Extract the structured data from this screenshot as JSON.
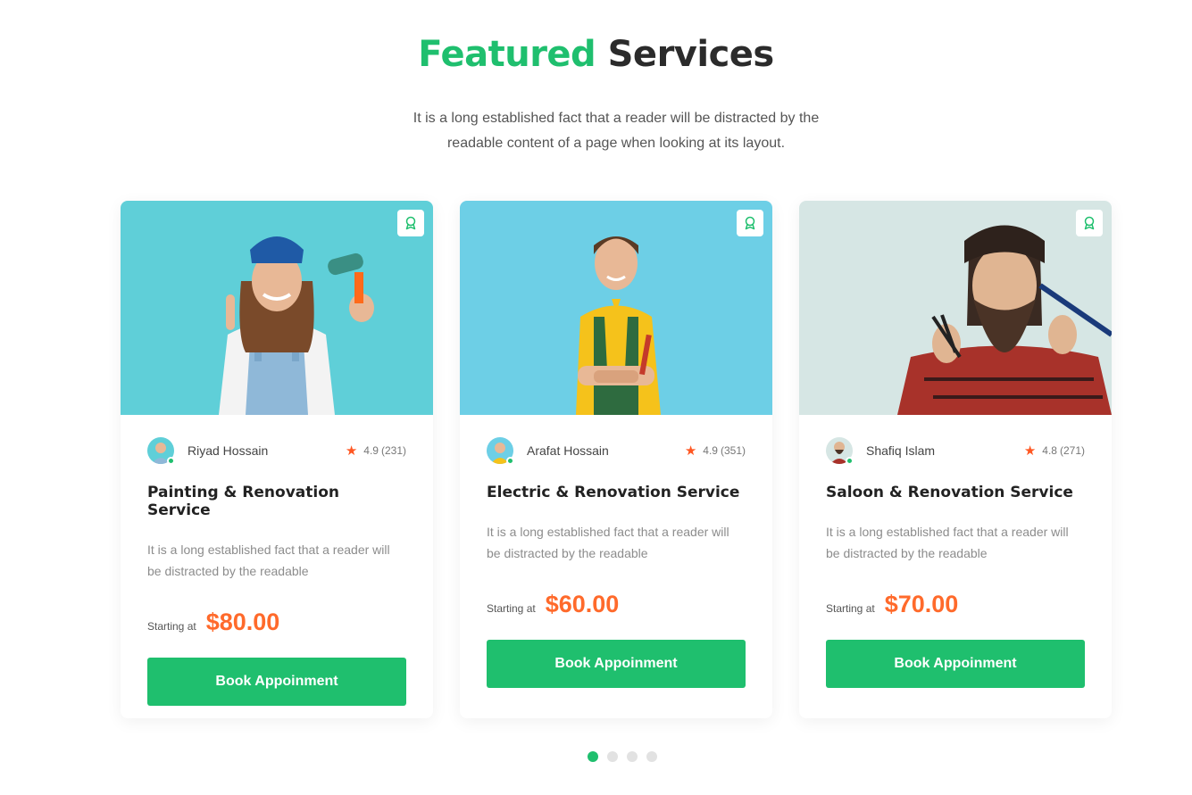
{
  "heading": {
    "accent": "Featured",
    "rest": "Services"
  },
  "subtitle": "It is a long established fact that a reader will be distracted by the readable content of a page when looking at its layout.",
  "colors": {
    "accent": "#1fbf6e",
    "price": "#ff6a2b",
    "star": "#ff5722"
  },
  "cards": [
    {
      "provider": "Riyad Hossain",
      "rating": "4.9",
      "reviews": "(231)",
      "title": "Painting & Renovation Service",
      "description": "It is a long established fact that a reader will be distracted by the readable",
      "price_label": "Starting at",
      "price": "$80.00",
      "button": "Book Appoinment",
      "photo_bg": "#5fcfd8",
      "badge_icon": "award-icon"
    },
    {
      "provider": "Arafat Hossain",
      "rating": "4.9",
      "reviews": "(351)",
      "title": "Electric & Renovation Service",
      "description": "It is a long established fact that a reader will be distracted by the readable",
      "price_label": "Starting at",
      "price": "$60.00",
      "button": "Book Appoinment",
      "photo_bg": "#6dcfe6",
      "badge_icon": "award-icon"
    },
    {
      "provider": "Shafiq Islam",
      "rating": "4.8",
      "reviews": "(271)",
      "title": "Saloon & Renovation Service",
      "description": "It is a long established fact that a reader will be distracted by the readable",
      "price_label": "Starting at",
      "price": "$70.00",
      "button": "Book Appoinment",
      "photo_bg": "#d6e6e4",
      "badge_icon": "award-icon"
    }
  ],
  "pagination": {
    "pages": 4,
    "active_page": 1
  }
}
